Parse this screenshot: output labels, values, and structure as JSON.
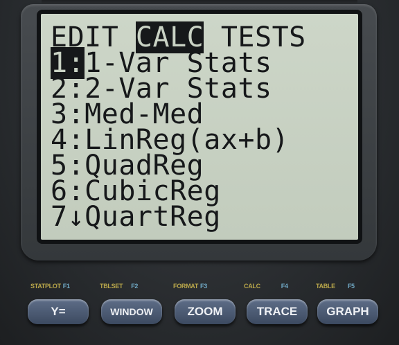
{
  "screen": {
    "lines": [
      {
        "pre": "EDIT ",
        "hl": "CALC",
        "post": " TESTS"
      },
      {
        "pre": "",
        "hl": "1:",
        "post": "1-Var Stats"
      },
      {
        "pre": "2:2-Var Stats",
        "hl": "",
        "post": ""
      },
      {
        "pre": "3:Med-Med",
        "hl": "",
        "post": ""
      },
      {
        "pre": "4:LinReg(ax+b)",
        "hl": "",
        "post": ""
      },
      {
        "pre": "5:QuadReg",
        "hl": "",
        "post": ""
      },
      {
        "pre": "6:CubicReg",
        "hl": "",
        "post": ""
      },
      {
        "pre": "7↓QuartReg",
        "hl": "",
        "post": ""
      }
    ]
  },
  "keys": {
    "labels": [
      {
        "primary": "STATPLOT",
        "secondary": "F1"
      },
      {
        "primary": "TBLSET",
        "secondary": "F2"
      },
      {
        "primary": "FORMAT",
        "secondary": "F3"
      },
      {
        "primary": "CALC",
        "secondary": "F4"
      },
      {
        "primary": "TABLE",
        "secondary": "F5"
      }
    ],
    "buttons": [
      "Y=",
      "WINDOW",
      "ZOOM",
      "TRACE",
      "GRAPH"
    ]
  },
  "colors": {
    "lcd": "#c6cfc1",
    "pixel": "#16181a",
    "key": "#4c5a72",
    "label_gold": "#b8a64a",
    "label_blue": "#6fa8c4"
  }
}
